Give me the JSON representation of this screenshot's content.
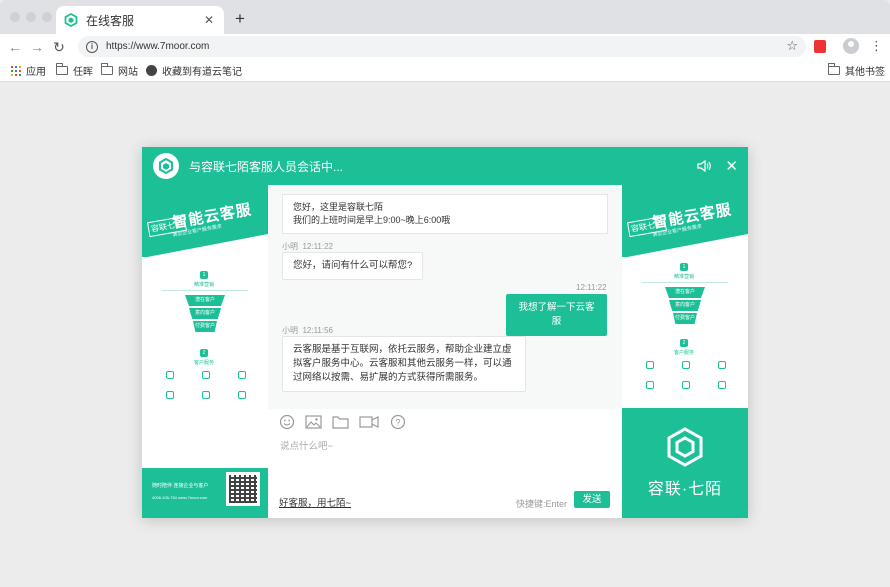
{
  "browser": {
    "tab_title": "在线客服",
    "url": "https://www.7moor.com",
    "bookmarks": [
      "应用",
      "任晖",
      "网站",
      "收藏到有道云笔记"
    ],
    "other_bookmarks": "其他书签"
  },
  "chat": {
    "header_title": "与容联七陌客服人员会话中...",
    "notice_line1": "您好，这里是容联七陌",
    "notice_line2": "我们的上班时间是早上9:00~晚上6:00哦",
    "messages": [
      {
        "sender": "小明",
        "time": "12:11:22",
        "text": "您好，请问有什么可以帮您?"
      },
      {
        "sender": "",
        "time": "12:11:22",
        "text": "我想了解一下云客服"
      },
      {
        "sender": "小明",
        "time": "12:11:56",
        "text": "云客服是基于互联网，依托云服务，帮助企业建立虚拟客户服务中心。云客服和其他云服务一样，可以通过网络以按需、易扩展的方式获得所需服务。"
      }
    ],
    "input_placeholder": "说点什么吧~",
    "slogan": "好客服，用七陌~",
    "shortcut_hint": "快捷键:Enter",
    "send_label": "发送"
  },
  "side_banner": {
    "big_text": "智能云客服",
    "tag_text": "容联七陌",
    "sub_text": "满足企业客户服务需求",
    "section1": "精准营销",
    "section2": "客户服务",
    "funnel": [
      "潜在客户",
      "意向客户",
      "付费客户"
    ],
    "footer_line1": "随时陪伴  连接企业与客户",
    "footer_line2": "4008-105-754  www.7moor.com",
    "brand_name": "容联·七陌"
  },
  "colors": {
    "accent": "#1dbf97"
  }
}
